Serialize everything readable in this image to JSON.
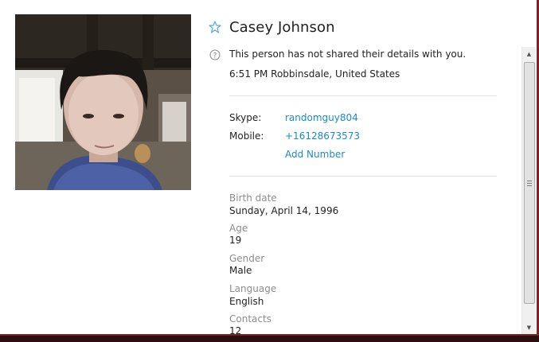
{
  "profile": {
    "name": "Casey Johnson",
    "notice": "This person has not shared their details with you.",
    "local_time": "6:51 PM Robbinsdale, United States",
    "photo_icon": "profile-photo"
  },
  "contact": {
    "skype_label": "Skype:",
    "skype_value": "randomguy804",
    "mobile_label": "Mobile:",
    "mobile_value": "+16128673573",
    "add_number": "Add Number"
  },
  "details": [
    {
      "label": "Birth date",
      "value": "Sunday, April 14, 1996"
    },
    {
      "label": "Age",
      "value": "19"
    },
    {
      "label": "Gender",
      "value": "Male"
    },
    {
      "label": "Language",
      "value": "English"
    },
    {
      "label": "Contacts",
      "value": "12"
    }
  ],
  "icons": {
    "favorite": "star-outline-icon",
    "info": "question-circle-icon"
  },
  "colors": {
    "link": "#1a8ac9",
    "label_gray": "#8c8c8c",
    "divider": "#e2e2e2",
    "window_edge": "#7d2323"
  }
}
